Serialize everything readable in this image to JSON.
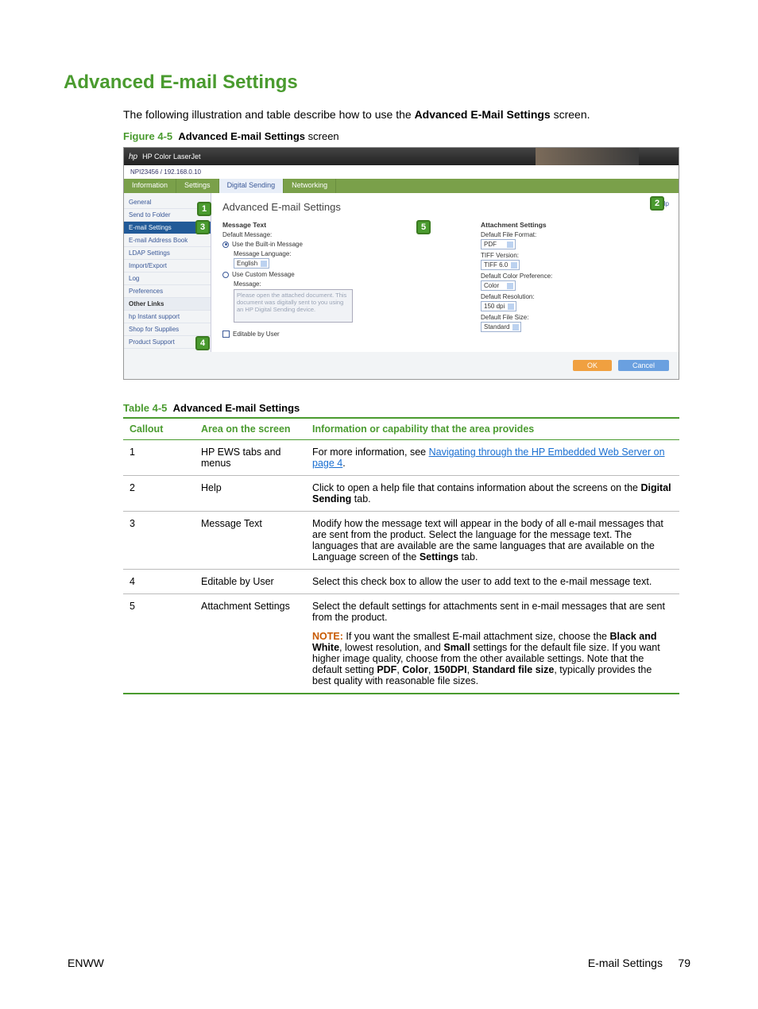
{
  "heading": "Advanced E-mail Settings",
  "intro_pre": "The following illustration and table describe how to use the ",
  "intro_bold": "Advanced E-Mail Settings",
  "intro_post": " screen.",
  "figure": {
    "num": "Figure 4-5",
    "title": "Advanced E-mail Settings",
    "suffix": " screen"
  },
  "ss": {
    "brand": "HP Color LaserJet",
    "sub": "NPI23456 / 192.168.0.10",
    "tabs": [
      "Information",
      "Settings",
      "Digital Sending",
      "Networking"
    ],
    "left": {
      "group1": [
        "General",
        "Send to Folder"
      ],
      "selected": "E-mail Settings",
      "group2": [
        "E-mail Address Book",
        "LDAP Settings",
        "Import/Export",
        "Log",
        "Preferences"
      ],
      "other_links_hdr": "Other Links",
      "group3": [
        "hp Instant support",
        "Shop for Supplies",
        "Product Support"
      ]
    },
    "page_title": "Advanced E-mail Settings",
    "help": "Help",
    "msg": {
      "title": "Message Text",
      "default_msg": "Default Message:",
      "use_builtin": "Use the Built-in Message",
      "msg_lang": "Message Language:",
      "lang_val": "English",
      "use_custom": "Use Custom Message",
      "message_lbl": "Message:",
      "textarea": "Please open the attached document. This document was digitally sent to you using an HP Digital Sending device.",
      "editable": "Editable by User"
    },
    "att": {
      "title": "Attachment Settings",
      "file_fmt": "Default File Format:",
      "file_fmt_val": "PDF",
      "tiff_ver": "TIFF Version:",
      "tiff_ver_val": "TIFF 6.0",
      "color_pref": "Default Color Preference:",
      "color_pref_val": "Color",
      "resolution": "Default Resolution:",
      "resolution_val": "150 dpi",
      "file_size": "Default File Size:",
      "file_size_val": "Standard"
    },
    "ok": "OK",
    "cancel": "Cancel"
  },
  "callouts": {
    "c1": "1",
    "c2": "2",
    "c3": "3",
    "c4": "4",
    "c5": "5"
  },
  "table": {
    "caption_num": "Table 4-5",
    "caption_title": "Advanced E-mail Settings",
    "headers": [
      "Callout",
      "Area on the screen",
      "Information or capability that the area provides"
    ],
    "rows": {
      "r1": {
        "c": "1",
        "area": "HP EWS tabs and menus",
        "info_pre": "For more information, see ",
        "link": "Navigating through the HP Embedded Web Server on page 4",
        "info_post": "."
      },
      "r2": {
        "c": "2",
        "area": "Help",
        "pre": "Click to open a help file that contains information about the screens on the ",
        "b": "Digital Sending",
        "post": " tab."
      },
      "r3": {
        "c": "3",
        "area": "Message Text",
        "pre": "Modify how the message text will appear in the body of all e-mail messages that are sent from the product. Select the language for the message text. The languages that are available are the same languages that are available on the Language screen of the ",
        "b": "Settings",
        "post": " tab."
      },
      "r4": {
        "c": "4",
        "area": "Editable by User",
        "text": "Select this check box to allow the user to add text to the e-mail message text."
      },
      "r5": {
        "c": "5",
        "area": "Attachment Settings",
        "p1": "Select the default settings for attachments sent in e-mail messages that are sent from the product.",
        "note": "NOTE:",
        "n_t1": " If you want the smallest E-mail attachment size, choose the ",
        "n_b1": "Black and White",
        "n_t2": ", lowest resolution, and ",
        "n_b2": "Small",
        "n_t3": " settings for the default file size. If you want higher image quality, choose from the other available settings. Note that the default setting ",
        "n_b3": "PDF",
        "n_c1": ", ",
        "n_b4": "Color",
        "n_c2": ", ",
        "n_b5": "150DPI",
        "n_c3": ", ",
        "n_b6": "Standard file size",
        "n_t4": ", typically provides the best quality with reasonable file sizes."
      }
    }
  },
  "footer": {
    "left": "ENWW",
    "right_label": "E-mail Settings",
    "page": "79"
  }
}
